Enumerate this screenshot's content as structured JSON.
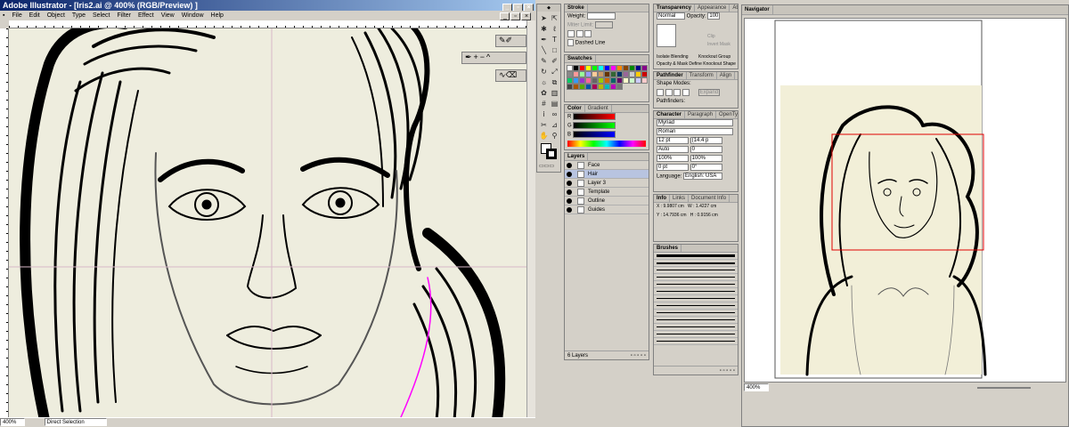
{
  "window": {
    "title": "Adobe Illustrator - [Iris2.ai @ 400% (RGB/Preview) ]",
    "menu": [
      "File",
      "Edit",
      "Object",
      "Type",
      "Select",
      "Filter",
      "Effect",
      "View",
      "Window",
      "Help"
    ]
  },
  "status": {
    "zoom": "400%",
    "tool": "Direct Selection"
  },
  "stroke": {
    "tab": "Stroke",
    "weight_label": "Weight:",
    "miter_label": "Miter Limit:",
    "dashed_label": "Dashed Line"
  },
  "transparency": {
    "tabs": [
      "Transparency",
      "Appearance",
      "Attributes"
    ],
    "mode": "Normal",
    "opacity_label": "Opacity:",
    "opacity": "100",
    "clip": "Clip",
    "invert": "Invert Mask",
    "isolate": "Isolate Blending",
    "knockout": "Knockout Group",
    "opacity_mask": "Opacity & Mask Define Knockout Shape"
  },
  "swatches": {
    "tab": "Swatches",
    "colors": [
      "#ffffff",
      "#000000",
      "#ff0000",
      "#ffff00",
      "#00ff00",
      "#00ffff",
      "#0000ff",
      "#ff00ff",
      "#ff8800",
      "#884400",
      "#008800",
      "#000088",
      "#880088",
      "#888888",
      "#ff9999",
      "#99ff99",
      "#9999ff",
      "#ffcc99",
      "#cc9966",
      "#663300",
      "#336633",
      "#003366",
      "#996699",
      "#cccccc",
      "#ffcc00",
      "#cc0000",
      "#00cc66",
      "#3399ff",
      "#9933cc",
      "#ff6699",
      "#666666",
      "#99cc00",
      "#cc6600",
      "#006666",
      "#660066",
      "#ffffcc",
      "#ccffcc",
      "#ccccff",
      "#ffcccc",
      "#444444",
      "#aa5500",
      "#55aa00",
      "#0055aa",
      "#aa0055",
      "#bbbb00",
      "#00bbbb",
      "#bb00bb",
      "#777777"
    ]
  },
  "pathfinder": {
    "tabs": [
      "Pathfinder",
      "Transform",
      "Align"
    ],
    "shape_modes": "Shape Modes:",
    "pathfinders": "Pathfinders:",
    "expand": "Expand"
  },
  "color": {
    "tabs": [
      "Color",
      "Gradient"
    ],
    "channels": [
      "R",
      "G",
      "B"
    ]
  },
  "character": {
    "tabs": [
      "Character",
      "Paragraph",
      "OpenType"
    ],
    "font": "Myriad",
    "style": "Roman",
    "size": "12 pt",
    "leading": "(14.4 p",
    "kerning": "Auto",
    "tracking": "0",
    "hscale": "100%",
    "vscale": "100%",
    "baseline": "0 pt",
    "rotation": "0°",
    "language_label": "Language:",
    "language": "English: USA"
  },
  "layers": {
    "tab": "Layers",
    "items": [
      "Face",
      "Hair",
      "Layer 3",
      "Template",
      "Outline",
      "Guides"
    ],
    "count": "6 Layers"
  },
  "info": {
    "tabs": [
      "Info",
      "Links",
      "Document Info"
    ],
    "x": "X : 9.9807 cm",
    "y": "Y : 14.7936 cm",
    "w": "W : 1.4227 cm",
    "h": "H : 0.9156 cm"
  },
  "brushes": {
    "tab": "Brushes"
  },
  "navigator": {
    "tab": "Navigator",
    "zoom": "400%"
  }
}
